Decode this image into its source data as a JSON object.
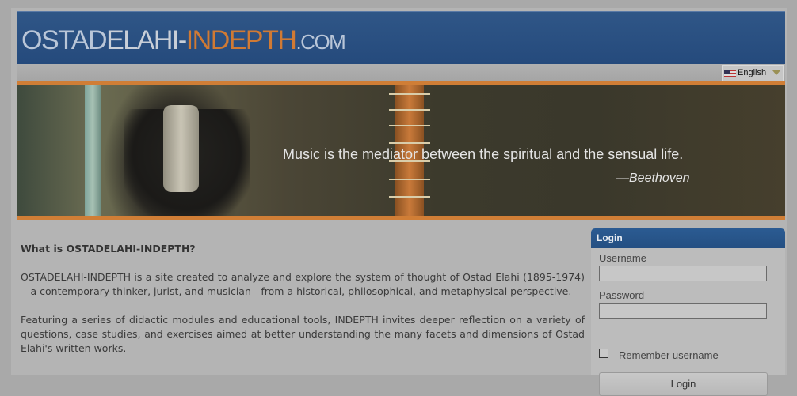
{
  "header": {
    "logo_part1": "OSTAD",
    "logo_part2": "ELAHI-",
    "logo_part3": "INDEPTH",
    "logo_part4": ".COM"
  },
  "language": {
    "selected": "English",
    "flag_icon": "us-flag-icon"
  },
  "banner": {
    "quote": "Music is the mediator between the spiritual and the sensual life.",
    "author": "—Beethoven"
  },
  "main": {
    "heading": "What is OSTADELAHI-INDEPTH?",
    "paragraph1": "OSTADELAHI-INDEPTH is a site created to analyze and explore the system of thought of Ostad Elahi (1895-1974)—a contemporary thinker, jurist, and musician—from a historical, philosophical, and metaphysical perspective.",
    "paragraph2": "Featuring a series of didactic modules and educational tools, INDEPTH invites deeper reflection on a variety of questions, case studies, and exercises aimed at better understanding the many facets and dimensions of Ostad Elahi's written works."
  },
  "login": {
    "title": "Login",
    "username_label": "Username",
    "username_value": "",
    "password_label": "Password",
    "password_value": "",
    "remember_label": "Remember username",
    "remember_checked": false,
    "button_label": "Login"
  },
  "colors": {
    "header_blue": "#2f5687",
    "accent_orange": "#d07e36",
    "login_header": "#2b5b92"
  }
}
